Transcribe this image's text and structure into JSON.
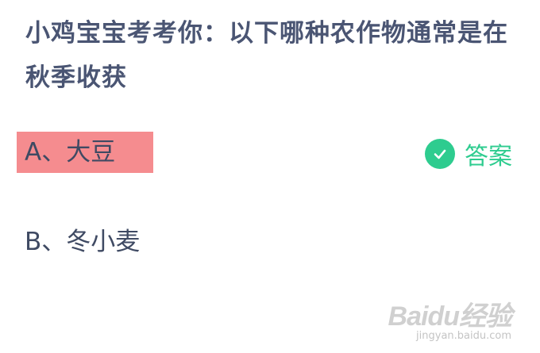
{
  "question": {
    "text": "小鸡宝宝考考你：以下哪种农作物通常是在秋季收获"
  },
  "options": [
    {
      "label": "A、大豆",
      "highlight_color": "#f58c8f"
    },
    {
      "label": "B、冬小麦"
    }
  ],
  "answer": {
    "label": "答案",
    "icon": "check-circle-icon",
    "color": "#2ecc8f"
  },
  "watermark": {
    "brand": "Baidu经验",
    "url": "jingyan.baidu.com"
  }
}
